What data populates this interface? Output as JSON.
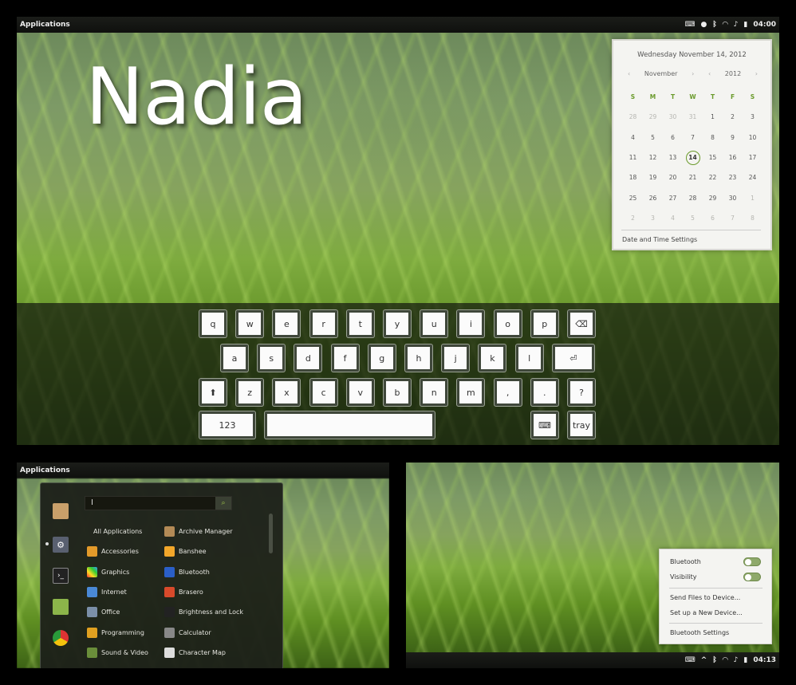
{
  "screen_main": {
    "panel_title": "Applications",
    "tray_icons": [
      "keyboard-icon",
      "accessibility-icon",
      "bluetooth-icon",
      "wifi-icon",
      "volume-icon",
      "battery-icon"
    ],
    "clock": "04:00",
    "wallpaper_text": "Nadia",
    "calendar": {
      "date_heading": "Wednesday November 14, 2012",
      "month": "November",
      "year": "2012",
      "weekdays": [
        "S",
        "M",
        "T",
        "W",
        "T",
        "F",
        "S"
      ],
      "weeks": [
        [
          "28",
          "29",
          "30",
          "31",
          "1",
          "2",
          "3"
        ],
        [
          "4",
          "5",
          "6",
          "7",
          "8",
          "9",
          "10"
        ],
        [
          "11",
          "12",
          "13",
          "14",
          "15",
          "16",
          "17"
        ],
        [
          "18",
          "19",
          "20",
          "21",
          "22",
          "23",
          "24"
        ],
        [
          "25",
          "26",
          "27",
          "28",
          "29",
          "30",
          "1"
        ],
        [
          "2",
          "3",
          "4",
          "5",
          "6",
          "7",
          "8"
        ]
      ],
      "today": "14",
      "settings_link": "Date and Time Settings"
    },
    "keyboard": {
      "row1": [
        "q",
        "w",
        "e",
        "r",
        "t",
        "y",
        "u",
        "i",
        "o",
        "p",
        "⌫"
      ],
      "row2": [
        "a",
        "s",
        "d",
        "f",
        "g",
        "h",
        "j",
        "k",
        "l",
        "⏎"
      ],
      "row3": [
        "⬆",
        "z",
        "x",
        "c",
        "v",
        "b",
        "n",
        "m",
        ",",
        ".",
        "?"
      ],
      "numbers_key": "123",
      "tray_key": "tray",
      "keyboard_icon": "⌨"
    }
  },
  "screen_menu": {
    "panel_title": "Applications",
    "search_value": "I",
    "categories": [
      {
        "label": "All Applications",
        "icon": ""
      },
      {
        "label": "Accessories",
        "icon": "accessories-icon"
      },
      {
        "label": "Graphics",
        "icon": "graphics-icon"
      },
      {
        "label": "Internet",
        "icon": "internet-icon"
      },
      {
        "label": "Office",
        "icon": "office-icon"
      },
      {
        "label": "Programming",
        "icon": "programming-icon"
      },
      {
        "label": "Sound & Video",
        "icon": "sound-video-icon"
      }
    ],
    "apps": [
      {
        "label": "Archive Manager",
        "icon": "archive-icon"
      },
      {
        "label": "Banshee",
        "icon": "banshee-icon"
      },
      {
        "label": "Bluetooth",
        "icon": "bluetooth-icon"
      },
      {
        "label": "Brasero",
        "icon": "brasero-icon"
      },
      {
        "label": "Brightness and Lock",
        "icon": "brightness-icon"
      },
      {
        "label": "Calculator",
        "icon": "calculator-icon"
      },
      {
        "label": "Character Map",
        "icon": "character-map-icon"
      }
    ]
  },
  "screen_bluetooth": {
    "clock": "04:13",
    "menu": {
      "bluetooth_label": "Bluetooth",
      "visibility_label": "Visibility",
      "send_files": "Send Files to Device...",
      "setup_device": "Set up a New Device...",
      "settings": "Bluetooth Settings"
    }
  },
  "colors": {
    "accent": "#6a9a2b",
    "panel": "#131411",
    "popup": "#f4f4f1"
  }
}
